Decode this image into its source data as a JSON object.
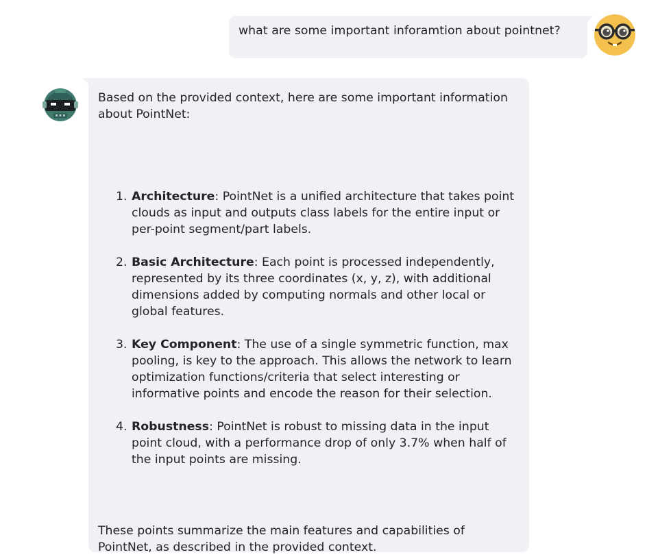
{
  "user_message": {
    "text": "what are some important inforamtion about pointnet?",
    "avatar_icon": "nerd-face-icon"
  },
  "bot_message": {
    "avatar_icon": "robot-icon",
    "intro": "Based on the provided context, here are some important information about PointNet:",
    "items": [
      {
        "number": "1.",
        "term": "Architecture",
        "text": ": PointNet is a unified architecture that takes point clouds as input and outputs class labels for the entire input or per-point segment/part labels."
      },
      {
        "number": "2.",
        "term": "Basic Architecture",
        "text": ": Each point is processed independently, represented by its three coordinates (x, y, z), with additional dimensions added by computing normals and other local or global features."
      },
      {
        "number": "3.",
        "term": "Key Component",
        "text": ": The use of a single symmetric function, max pooling, is key to the approach. This allows the network to learn optimization functions/criteria that select interesting or informative points and encode the reason for their selection."
      },
      {
        "number": "4.",
        "term": "Robustness",
        "text": ": PointNet is robust to missing data in the input point cloud, with a performance drop of only 3.7% when half of the input points are missing."
      }
    ],
    "outro": "These points summarize the main features and capabilities of PointNet, as described in the provided context."
  },
  "colors": {
    "bubble_bg": "#f0f1f4",
    "text": "#222326",
    "user_avatar_face": "#f4c04e",
    "bot_avatar_body": "#3f7a6e"
  }
}
